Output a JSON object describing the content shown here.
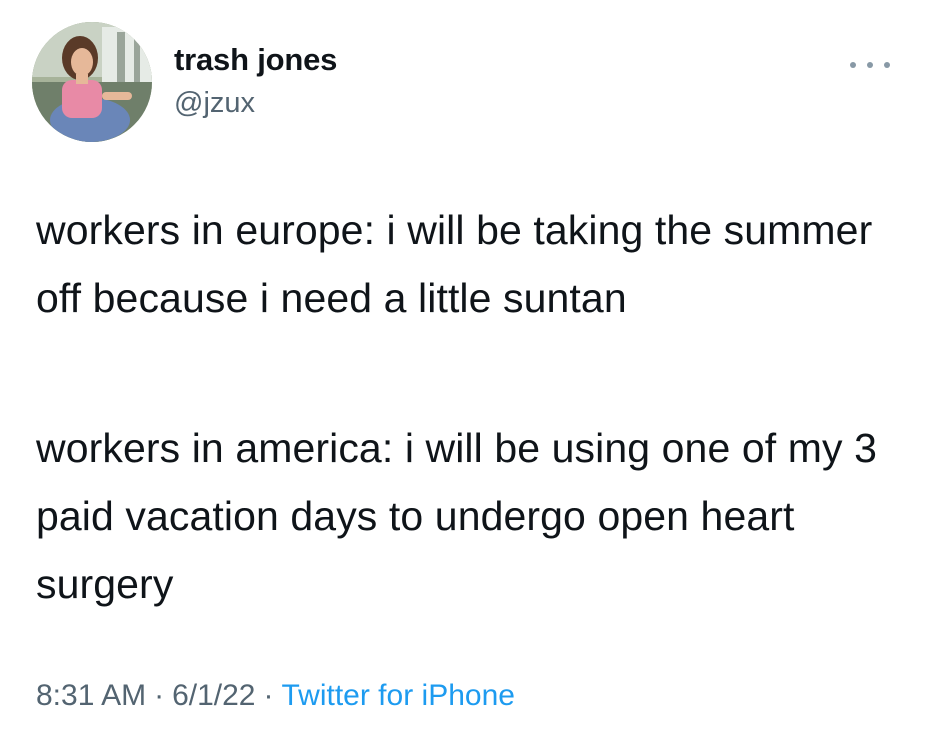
{
  "author": {
    "display_name": "trash jones",
    "handle": "@jzux"
  },
  "menu": {
    "icon": "more-horizontal-icon"
  },
  "tweet": {
    "paragraphs": [
      "workers in europe: i will be taking the summer off because i need a little suntan",
      "workers in america: i will be using one of my 3 paid vacation days to undergo open heart surgery"
    ]
  },
  "meta": {
    "time": "8:31 AM",
    "date": "6/1/22",
    "separator": "·",
    "source": "Twitter for iPhone"
  },
  "colors": {
    "text": "#0f1419",
    "secondary": "#536471",
    "link": "#1d9bf0"
  }
}
